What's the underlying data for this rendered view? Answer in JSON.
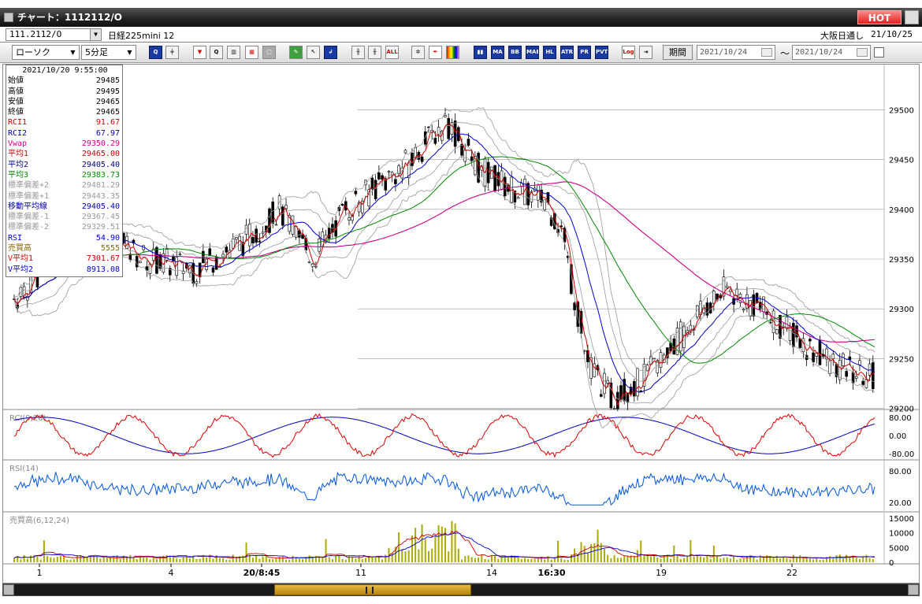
{
  "window": {
    "title": "チャート：1112112/O",
    "hot_label": "HOT"
  },
  "symbol_bar": {
    "code": "111.2112/O",
    "name": "日経225mini 12",
    "session": "大阪日通し",
    "date": "21/10/25"
  },
  "toolbar": {
    "chart_type": "ローソク",
    "interval": "5分足",
    "buttons": [
      {
        "name": "zoom-icon",
        "label": "Q",
        "style": "blue"
      },
      {
        "name": "crosshair-icon",
        "label": "╪",
        "style": ""
      },
      {
        "name": "arrow-down-icon",
        "label": "▼",
        "style": "red"
      },
      {
        "name": "magnify-icon",
        "label": "Q",
        "style": ""
      },
      {
        "name": "bar-chart-icon",
        "label": "▥",
        "style": ""
      },
      {
        "name": "grid-icon",
        "label": "▦",
        "style": "red"
      },
      {
        "name": "note-icon",
        "label": "□",
        "style": "gray"
      },
      {
        "name": "pencil-icon",
        "label": "✎",
        "style": "grn"
      },
      {
        "name": "pointer-icon",
        "label": "↖",
        "style": ""
      },
      {
        "name": "return-icon",
        "label": "↲",
        "style": "blue"
      },
      {
        "name": "candle-left-icon",
        "label": "╫",
        "style": ""
      },
      {
        "name": "candle-right-icon",
        "label": "╫",
        "style": ""
      },
      {
        "name": "all-button",
        "label": "ALL",
        "style": "red"
      },
      {
        "name": "gear-icon",
        "label": "✲",
        "style": ""
      },
      {
        "name": "wrench-icon",
        "label": "✒",
        "style": "red"
      },
      {
        "name": "palette-icon",
        "label": "",
        "style": "rb"
      },
      {
        "name": "indicator-bars-icon",
        "label": "▮▮",
        "style": "blue"
      },
      {
        "name": "ma-button",
        "label": "MA",
        "style": "blue"
      },
      {
        "name": "bb-button",
        "label": "BB",
        "style": "blue"
      },
      {
        "name": "mae-button",
        "label": "MAE",
        "style": "blue"
      },
      {
        "name": "hl-button",
        "label": "HL",
        "style": "blue"
      },
      {
        "name": "atr-button",
        "label": "ATR",
        "style": "blue"
      },
      {
        "name": "ppr-button",
        "label": "PR",
        "style": "blue"
      },
      {
        "name": "pvt-button",
        "label": "PVT",
        "style": "blue"
      },
      {
        "name": "log-button",
        "label": "Log",
        "style": "red"
      },
      {
        "name": "export-icon",
        "label": "⇥",
        "style": ""
      }
    ],
    "period_label": "期間",
    "date_from": "2021/10/24",
    "date_to": "2021/10/24",
    "tilde": "～"
  },
  "info_panel": {
    "datetime": "2021/10/20  9:55:00",
    "rows": [
      {
        "label": "始値",
        "value": "29485",
        "color": "#000000"
      },
      {
        "label": "高値",
        "value": "29495",
        "color": "#000000"
      },
      {
        "label": "安値",
        "value": "29465",
        "color": "#000000"
      },
      {
        "label": "終値",
        "value": "29465",
        "color": "#000000"
      },
      {
        "label": "RCI1",
        "value": "91.67",
        "color": "#cc0000"
      },
      {
        "label": "RCI2",
        "value": "67.97",
        "color": "#0000aa"
      },
      {
        "label": "Vwap",
        "value": "29350.29",
        "color": "#cc0088"
      },
      {
        "label": "平均1",
        "value": "29465.00",
        "color": "#cc0000"
      },
      {
        "label": "平均2",
        "value": "29405.40",
        "color": "#000088"
      },
      {
        "label": "平均3",
        "value": "29383.73",
        "color": "#008800"
      },
      {
        "label": "標準偏差+2",
        "value": "29481.29",
        "color": "#999999"
      },
      {
        "label": "標準偏差+1",
        "value": "29443.35",
        "color": "#999999"
      },
      {
        "label": "移動平均線",
        "value": "29405.40",
        "color": "#0000aa"
      },
      {
        "label": "標準偏差-1",
        "value": "29367.45",
        "color": "#999999"
      },
      {
        "label": "標準偏差-2",
        "value": "29329.51",
        "color": "#999999"
      },
      {
        "label": "RSI",
        "value": "54.90",
        "color": "#0000cc"
      },
      {
        "label": "売買高",
        "value": "5555",
        "color": "#886600"
      },
      {
        "label": "V平均1",
        "value": "7301.67",
        "color": "#cc0000"
      },
      {
        "label": "V平均2",
        "value": "8913.08",
        "color": "#0000cc"
      }
    ]
  },
  "chart_data": {
    "type": "candlestick",
    "price_axis": {
      "ticks": [
        29500,
        29450,
        29400,
        29350,
        29300,
        29250,
        29200
      ]
    },
    "rci_panel": {
      "label": "RCI(9,26)",
      "ticks": [
        "80.00",
        "0.00",
        "-80.00"
      ]
    },
    "rsi_panel": {
      "label": "RSI(14)",
      "ticks": [
        "80.00",
        "20.00"
      ]
    },
    "volume_panel": {
      "label": "売買高(6,12,24)",
      "ticks": [
        "15000",
        "10000",
        "5000",
        "0"
      ]
    },
    "x_labels": [
      "1",
      "4",
      "20/8:45",
      "11",
      "14",
      "16:30",
      "19",
      "22"
    ],
    "colors": {
      "up": "#ffffff",
      "down": "#000000",
      "ma1": "#cc0000",
      "ma2": "#0000cc",
      "ma3": "#008800",
      "vwap": "#cc0088",
      "band": "#999999",
      "rci1": "#dd0000",
      "rci2": "#0000bb",
      "rsi": "#0055dd",
      "volume": "#aaaa00"
    }
  }
}
